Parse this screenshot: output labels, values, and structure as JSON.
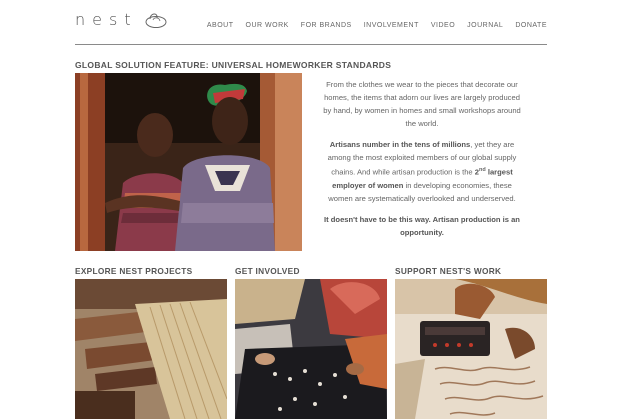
{
  "brand": {
    "logo_text": "nest"
  },
  "nav": [
    {
      "label": "ABOUT"
    },
    {
      "label": "OUR WORK"
    },
    {
      "label": "FOR BRANDS"
    },
    {
      "label": "INVOLVEMENT"
    },
    {
      "label": "VIDEO"
    },
    {
      "label": "JOURNAL"
    },
    {
      "label": "DONATE"
    }
  ],
  "feature": {
    "title": "GLOBAL SOLUTION FEATURE: UNIVERSAL HOMEWORKER STANDARDS",
    "para1": "From the clothes we wear to the pieces that decorate our homes, the items that adorn our lives are largely produced by hand, by women in homes and small workshops around the world.",
    "para2_bold": "Artisans number in the tens of millions",
    "para2_rest": ", yet they are among the most exploited members of our global supply chains. And while artisan production  is the ",
    "para2_bold2": "2",
    "para2_sup": "nd",
    "para2_bold3": " largest employer of women",
    "para2_end": " in developing economies, these women are systematically overlooked and underserved.",
    "closing": "It doesn't have to be this way. Artisan production is an opportunity."
  },
  "sections": [
    {
      "title": "EXPLORE NEST PROJECTS"
    },
    {
      "title": "GET INVOLVED"
    },
    {
      "title": "SUPPORT NEST'S WORK"
    }
  ],
  "colors": {
    "text": "#555555",
    "rule": "#8a8a8a",
    "background": "#ffffff"
  }
}
